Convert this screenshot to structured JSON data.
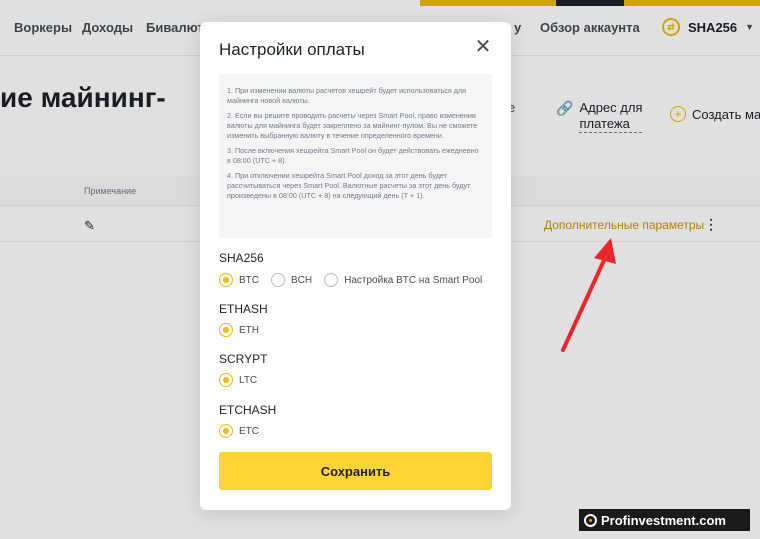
{
  "nav": {
    "items": [
      "Воркеры",
      "Доходы",
      "Бивалюти"
    ],
    "trailing_item": "у",
    "account_overview": "Обзор аккаунта",
    "algorithm": "SHA256"
  },
  "page": {
    "title_fragment": "ие майнинг-",
    "right_fragment": "е",
    "payment_address_line1": "Адрес для",
    "payment_address_line2": "платежа",
    "create_label": "Создать майн",
    "column_note": "Примечание",
    "extra_params": "Дополнительные параметры"
  },
  "modal": {
    "title": "Настройки оплаты",
    "info": [
      "1. При изменении валюты расчетов хешрейт будет использоваться для майнинга новой валюты.",
      "2. Если вы решите проводить расчеты через Smart Pool, право изменения валюты для майнинга будет закреплено за майнинг-пулом. Вы не сможете изменить выбранную валюту в течение определенного времени.",
      "3. После включения хешрейта Smart Pool он будет действовать ежедневно в 08:00 (UTC + 8).",
      "4. При отключении хешрейта Smart Pool доход за этот день будет рассчитываться через Smart Pool. Валютные расчеты за этот день будут произведены в 08:00 (UTC + 8) на следующий день (T + 1)."
    ],
    "groups": [
      {
        "label": "SHA256",
        "options": [
          {
            "label": "BTC",
            "selected": true
          },
          {
            "label": "BCH",
            "selected": false
          },
          {
            "label": "Настройка BTC на Smart Pool",
            "selected": false
          }
        ]
      },
      {
        "label": "ETHASH",
        "options": [
          {
            "label": "ETH",
            "selected": true
          }
        ]
      },
      {
        "label": "SCRYPT",
        "options": [
          {
            "label": "LTC",
            "selected": true
          }
        ]
      },
      {
        "label": "ETCHASH",
        "options": [
          {
            "label": "ETC",
            "selected": true
          }
        ]
      }
    ],
    "save_label": "Сохранить"
  },
  "colors": {
    "accent": "#f0b90b",
    "button": "#fcd535",
    "link": "#c99400",
    "arrow": "#e8262b"
  },
  "watermark": "Profinvestment.com"
}
